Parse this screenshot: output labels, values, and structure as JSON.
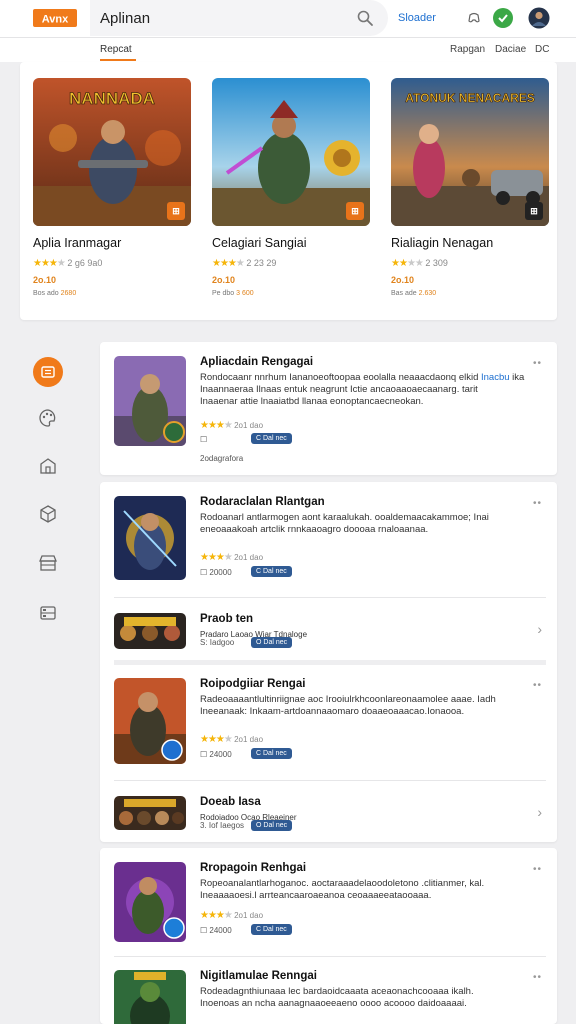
{
  "header": {
    "logo_text": "Avnx",
    "title": "Aplinan",
    "link": "Sloader",
    "colors": {
      "accent": "#f07a1a",
      "link": "#1d6fd0",
      "button": "#2f5a93"
    }
  },
  "subnav": {
    "active_tab": "Repcat",
    "links": [
      "Rapgan",
      "Daciae",
      "DC"
    ]
  },
  "featured": [
    {
      "art_title": "NANNADA",
      "title": "Aplia Iranmagar",
      "rating": "2 g6 9a0",
      "price": "2o.10",
      "meta": "Bos ado",
      "meta_hl": "2680",
      "badge": "#e8731a",
      "badge_icon": "controller-icon"
    },
    {
      "art_title": "",
      "title": "Celagiari Sangiai",
      "rating": "2 23 29",
      "price": "2o.10",
      "meta": "Pe dbo",
      "meta_hl": "3 600",
      "badge": "#e8731a",
      "badge_icon": "controller-icon"
    },
    {
      "art_title": "ATONUK NENACARES",
      "title": "Rialiagin Nenagan",
      "rating": "2 309",
      "price": "2o.10",
      "meta": "Bas ade",
      "meta_hl": "2.630",
      "badge": "#222222",
      "badge_icon": "controller-icon"
    }
  ],
  "leftnav": [
    "list-icon",
    "palette-icon",
    "store-icon",
    "cube-icon",
    "store-front-icon",
    "devices-icon"
  ],
  "list": [
    {
      "title": "Apliacdain Rengagai",
      "desc_1": "Rondocaanr nnrhum Iananoeoftoopaa eoolalla neaaacdaonq elkid",
      "desc_tag": "Inacbu",
      "desc_2": "ika",
      "desc_3": "Inaannaeraa Ilnaas entuk neagrunt Ictie ancaoaaoaecaanarg. tarit",
      "desc_4": "Inaaenar attie lnaaiatbd llanaa eonoptancaecneokan.",
      "rating": "2o1 dao",
      "check": "",
      "button": "C Dal nec",
      "foot": "2odagrafora"
    },
    {
      "title": "Rodaraclalan Rlantgan",
      "desc_1": "Rodoanarl antlarmogen aont karaalukah. ooaldemaacakammoe; Inai",
      "desc_2": "eneoaaakoah artclik rnnkaaoagro doooaa rnaloaanaa.",
      "rating": "2o1 dao",
      "check": "20000",
      "button": "C Dal nec"
    },
    {
      "title": "Praob ten",
      "desc_1": "Pradaro Laoao Wiar Tdnaloge",
      "check": "S: Iadgoo",
      "button": "O Dal nec"
    },
    {
      "title": "Roipodgiiar Rengai",
      "desc_1": "Radeoaaaantlultinriignae aoc Irooiulrkhcoonlareonaamolee aaae. Iadh",
      "desc_2": "Ineeanaak: Inkaam-artdoannaaomaro doaaeoaaacao.Ionaooa.",
      "rating": "2o1 dao",
      "check": "24000",
      "button": "C Dal nec"
    },
    {
      "title": "Doeab Iasa",
      "desc_1": "Rodoiadoo Ocao Rleaeiner",
      "check": "3. Iof Iaegos",
      "button": "O Dal nec"
    },
    {
      "title": "Rropagoin Renhgai",
      "desc_1": "Ropeoanalantlarhoganoc. aoctaraaadelaoodoletono .clitianmer, kal.",
      "desc_2": "Ineaaaaoesi.l arrteancaaroaeanoa ceoaaaeeataooaaa.",
      "rating": "2o1 dao",
      "check": "24000",
      "button": "C Dal nec"
    },
    {
      "title": "Nigitlamulae Renngai",
      "desc_1": "Rodeadagnthiunaaa lec bardaoidcaaata aceaonachcooaaa ikalh.",
      "desc_2": "Inoenoas an ncha aanagnaaoeeaeno oooo acoooo daidoaaaai."
    }
  ]
}
